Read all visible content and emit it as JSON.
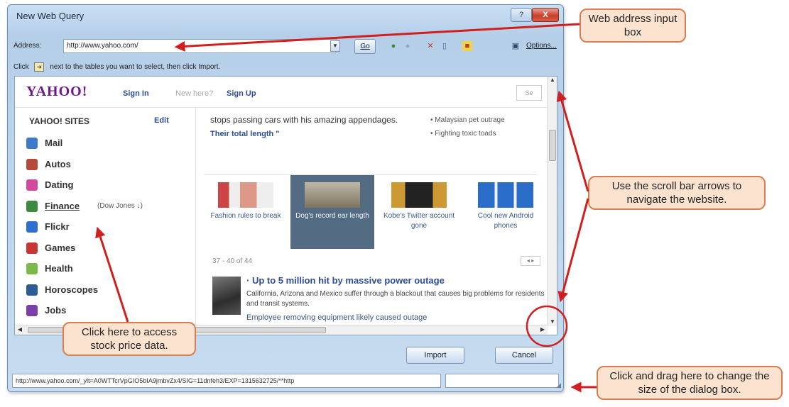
{
  "dialog": {
    "title": "New Web Query",
    "help_glyph": "?",
    "close_glyph": "X",
    "address_label": "Address:",
    "address_value": "http://www.yahoo.com/",
    "dropdown_glyph": "▼",
    "go_label": "Go",
    "options_label": "Options...",
    "instruction_before": "Click",
    "instruction_after": "next to the tables you want to select, then click Import.",
    "arrow_glyph": "➔",
    "import_label": "Import",
    "cancel_label": "Cancel",
    "status_url": "http://www.yahoo.com/_ylt=A0WTTcrVpGIO5bIA9jmbvZx4/SIG=11dnfeh3/EXP=1315632725/**http",
    "grip_glyph": "◢"
  },
  "yahoo": {
    "logo": "YAHOO!",
    "sign_in": "Sign In",
    "new_here": "New here?",
    "sign_up": "Sign Up",
    "search_glyph": "Se",
    "sites_title": "YAHOO! SITES",
    "edit_label": "Edit",
    "sites": [
      {
        "label": "Mail",
        "color": "#3d7ac9"
      },
      {
        "label": "Autos",
        "color": "#b64a3a"
      },
      {
        "label": "Dating",
        "color": "#d24a9e"
      },
      {
        "label": "Finance",
        "color": "#3c8a3f",
        "note": "(Dow Jones ↓)"
      },
      {
        "label": "Flickr",
        "color": "#2e6ed0"
      },
      {
        "label": "Games",
        "color": "#c93535"
      },
      {
        "label": "Health",
        "color": "#7cb84a"
      },
      {
        "label": "Horoscopes",
        "color": "#2b5c96"
      },
      {
        "label": "Jobs",
        "color": "#7a3fa8"
      }
    ],
    "story_text": "stops passing cars with his amazing appendages.",
    "story_link": "Their total length \"",
    "side_links": [
      "• Malaysian pet outrage",
      "• Fighting toxic toads"
    ],
    "thumbs": [
      {
        "caption": "Fashion rules to break",
        "selected": false
      },
      {
        "caption": "Dog's record ear length",
        "selected": true
      },
      {
        "caption": "Kobe's Twitter account gone",
        "selected": false
      },
      {
        "caption": "Cool new Android phones",
        "selected": false
      }
    ],
    "pager": "37 - 40 of 44",
    "pager_btns": "◂ ▸",
    "news_title": "· Up to 5 million hit by massive power outage",
    "news_body": "California, Arizona and Mexico suffer through a blackout that causes big problems for residents and transit systems.",
    "news_link": "Employee removing equipment likely caused outage"
  },
  "callouts": {
    "web_address": "Web address input box",
    "scroll": "Use the scroll bar arrows to navigate the website.",
    "finance": "Click here to access stock price data.",
    "resize": "Click and drag here to change the size of the dialog box."
  },
  "colors": {
    "callout_fill": "#fbe3cf",
    "callout_border": "#d77f52",
    "arrow_red": "#d11f1f",
    "yahoo_purple": "#6a1a8a",
    "link_blue": "#2c4e9a"
  }
}
